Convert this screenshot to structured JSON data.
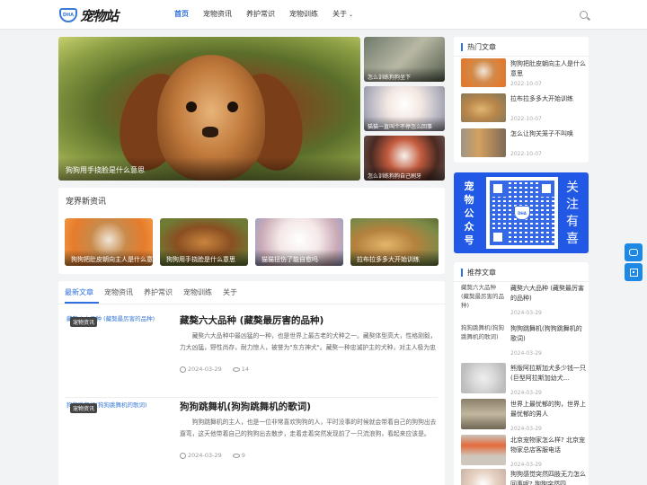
{
  "brand": {
    "logo_badge": "DHA",
    "logo_text": "宠物站"
  },
  "nav": {
    "items": [
      "首页",
      "宠物资讯",
      "养护常识",
      "宠物训练",
      "关于"
    ],
    "active": "首页"
  },
  "hero": {
    "main_caption": "狗狗用手挠脸是什么意思",
    "side": [
      "怎么训练狗狗坐下",
      "猫猫一直叫个不停怎么回事",
      "怎么训练狗狗自己刷牙"
    ]
  },
  "news": {
    "title": "宠界新资讯",
    "items": [
      "狗狗把肚皮朝向主人是什么意思",
      "狗狗用手挠脸是什么意思",
      "猫猫扭伤了能自愈吗",
      "拉布拉多多大开始训练"
    ]
  },
  "tabs": [
    "最新文章",
    "宠物资讯",
    "养护常识",
    "宠物训练",
    "关于"
  ],
  "articles": [
    {
      "thumb_alt": "藏獒六大品种 (藏獒最厉害的品种)",
      "tag": "宠物资讯",
      "title": "藏獒六大品种 (藏獒最厉害的品种)",
      "desc": "藏獒六大品种中最凶猛的一种，也是世界上最古老的犬种之一。藏獒体型高大，性格刚毅，力大凶猛，野性尚存，耐力惊人，被誉为\"东方神犬\"。藏獒一种忠诚护主的犬种，对主人极为忠诚。",
      "date": "2024-03-29",
      "views": "14"
    },
    {
      "thumb_alt": "狗狗跳舞机(狗狗跳舞机的歌词)",
      "tag": "宠物资讯",
      "title": "狗狗跳舞机(狗狗跳舞机的歌词)",
      "desc": "狗狗跳舞机的主人，也是一位非常喜欢狗狗的人，平时没事的时候就会带着自己的狗狗出去遛弯，这天他带着自己的狗狗出去散步，走着走着突然发现前了一只流浪狗，看起来应该是。",
      "date": "2024-03-29",
      "views": "9"
    }
  ],
  "hot": {
    "title": "热门文章",
    "items": [
      {
        "title": "狗狗把肚皮朝向主人是什么意思",
        "date": "2022-10-07"
      },
      {
        "title": "拉布拉多多大开始训练",
        "date": "2022-10-07"
      },
      {
        "title": "怎么让狗关笼子不叫唤",
        "date": "2022-10-07"
      }
    ]
  },
  "qr_banner": {
    "left_text": "宠物公众号",
    "right_text": "关注有喜",
    "center_badge": "DHA"
  },
  "recommend": {
    "title": "推荐文章",
    "items": [
      {
        "thumb_alt": "藏獒六大品种 (藏獒最厉害的品种)",
        "title": "藏獒六大品种 (藏獒最厉害的品种)",
        "date": "2024-03-29"
      },
      {
        "thumb_alt": "狗狗跳舞机(狗狗跳舞机的歌词)",
        "title": "狗狗跳舞机(狗狗跳舞机的歌词)",
        "date": "2024-03-29"
      },
      {
        "thumb_alt": "",
        "title": "熊版阿拉斯加犬多少钱一只(巨型阿拉斯加幼犬...",
        "date": "2024-03-29"
      },
      {
        "thumb_alt": "",
        "title": "世界上最忧郁的狗，世界上最忧郁的男人",
        "date": "2024-03-29"
      },
      {
        "thumb_alt": "",
        "title": "北京宠物家怎么样? 北京宠物家总店客服电话",
        "date": "2024-03-29"
      },
      {
        "thumb_alt": "",
        "title": "狗狗感觉突然四肢无力怎么回事呢? 狗狗突然四",
        "date": ""
      }
    ]
  },
  "icons": [
    "search-icon",
    "clock-icon",
    "eye-icon",
    "chat-icon",
    "qrcode-icon",
    "chevron-down-icon"
  ],
  "colors": {
    "accent": "#2f6fe0",
    "banner": "#2159e6",
    "float": "#1e88e5"
  }
}
